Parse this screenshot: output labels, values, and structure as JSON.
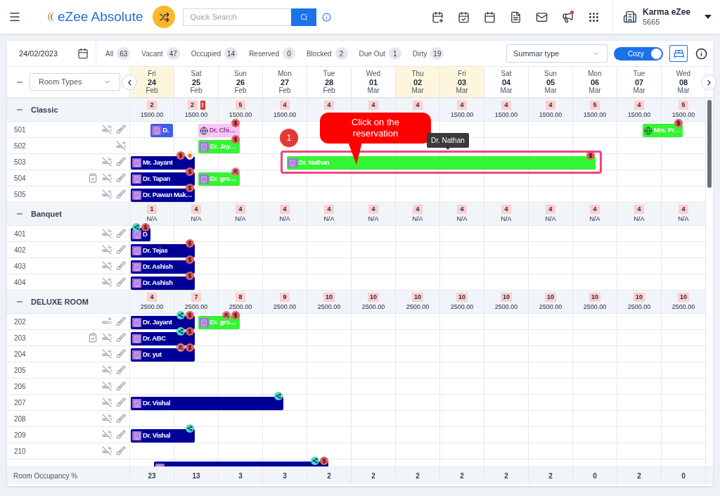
{
  "header": {
    "app_name": "eZee Absolute",
    "search": {
      "placeholder": "Quick Search"
    },
    "notification_dot": true,
    "property": {
      "name": "Karma eZee",
      "code": "5665"
    }
  },
  "filter_bar": {
    "date": "24/02/2023",
    "filters": [
      {
        "label": "All",
        "count": "63"
      },
      {
        "label": "Vacant",
        "count": "47"
      },
      {
        "label": "Occupied",
        "count": "14"
      },
      {
        "label": "Reserved",
        "count": "0"
      },
      {
        "label": "Blocked",
        "count": "2"
      },
      {
        "label": "Due Out",
        "count": "1"
      },
      {
        "label": "Dirty",
        "count": "19"
      }
    ],
    "type_select": {
      "value": "Summar type"
    },
    "view_toggle": {
      "label": "Cozy",
      "on": true
    }
  },
  "grid": {
    "room_type_select": {
      "value": "Room Types"
    },
    "days": [
      {
        "day": "Fri",
        "date": "24",
        "month": "Feb",
        "highlight": true
      },
      {
        "day": "Sat",
        "date": "25",
        "month": "Feb",
        "highlight": false
      },
      {
        "day": "Sun",
        "date": "26",
        "month": "Feb",
        "highlight": false
      },
      {
        "day": "Mon",
        "date": "27",
        "month": "Feb",
        "highlight": false
      },
      {
        "day": "Tue",
        "date": "28",
        "month": "Feb",
        "highlight": false
      },
      {
        "day": "Wed",
        "date": "01",
        "month": "Mar",
        "highlight": false
      },
      {
        "day": "Thu",
        "date": "02",
        "month": "Mar",
        "highlight": true
      },
      {
        "day": "Fri",
        "date": "03",
        "month": "Mar",
        "highlight": true
      },
      {
        "day": "Sat",
        "date": "04",
        "month": "Mar",
        "highlight": false
      },
      {
        "day": "Sun",
        "date": "05",
        "month": "Mar",
        "highlight": false
      },
      {
        "day": "Mon",
        "date": "06",
        "month": "Mar",
        "highlight": false
      },
      {
        "day": "Tue",
        "date": "07",
        "month": "Mar",
        "highlight": false
      },
      {
        "day": "Wed",
        "date": "08",
        "month": "Mar",
        "highlight": false
      }
    ],
    "groups": [
      {
        "name": "Classic",
        "expanded": true,
        "cells": [
          {
            "count": "2",
            "rate": "1500.00"
          },
          {
            "count": "2",
            "alert": "!",
            "rate": "1500.00"
          },
          {
            "count": "5",
            "rate": "1500.00"
          },
          {
            "count": "4",
            "rate": "1500.00"
          },
          {
            "count": "4"
          },
          {
            "count": "4"
          },
          {
            "count": "4"
          },
          {
            "count": "4",
            "rate": "1500.00"
          },
          {
            "count": "4",
            "rate": "1500.00"
          },
          {
            "count": "4",
            "rate": "1500.00"
          },
          {
            "count": "5",
            "rate": "1500.00"
          },
          {
            "count": "4",
            "rate": "1500.00"
          },
          {
            "count": "5",
            "rate": "1500.00"
          }
        ],
        "rooms": [
          {
            "number": "501",
            "icons": [
              {
                "kind": "no-smoking"
              },
              {
                "kind": "clean"
              }
            ],
            "reservations": [
              {
                "guest": "D.",
                "color": "#3f5fe8",
                "kind": "direct"
              },
              {
                "guest": "Dr. Chi…",
                "color": "#f7c6f7",
                "kind": "web",
                "badges": [
                  {
                    "kind": "dollar"
                  }
                ]
              },
              {
                "guest": "Mrs. Pr…",
                "color": "#33f533",
                "kind": "web",
                "badges": [
                  {
                    "kind": "dollar"
                  }
                ]
              }
            ]
          },
          {
            "number": "502",
            "icons": [
              {
                "kind": "no-smoking"
              }
            ],
            "reservations": [
              {
                "guest": "Dr. Jay…",
                "color": "#33f533",
                "kind": "direct",
                "badges": [
                  {
                    "kind": "dollar"
                  }
                ]
              }
            ]
          },
          {
            "number": "503",
            "icons": [
              {
                "kind": "no-smoking"
              },
              {
                "kind": "clean"
              }
            ],
            "reservations": [
              {
                "guest": "Mr. Jayant",
                "color": "#000099",
                "kind": "direct",
                "badges": [
                  {
                    "kind": "dollar"
                  },
                  {
                    "kind": "star"
                  }
                ]
              },
              {
                "guest": "Dr. Nathan",
                "color": "#33f533",
                "kind": "direct",
                "highlighted": true,
                "badges": [
                  {
                    "kind": "dollar"
                  }
                ]
              }
            ]
          },
          {
            "number": "504",
            "icons": [
              {
                "kind": "checklist"
              },
              {
                "kind": "no-smoking"
              },
              {
                "kind": "clean"
              }
            ],
            "reservations": [
              {
                "guest": "Dr. Tapan",
                "color": "#000099",
                "kind": "direct",
                "badges": [
                  {
                    "kind": "dollar"
                  }
                ]
              },
              {
                "guest": "Dr. gro…",
                "color": "#33f533",
                "kind": "direct",
                "badges": [
                  {
                    "kind": "group"
                  }
                ]
              }
            ]
          },
          {
            "number": "505",
            "icons": [
              {
                "kind": "no-smoking"
              },
              {
                "kind": "clean"
              }
            ],
            "reservations": [
              {
                "guest": "Dr. Pawan Mak…",
                "color": "#000099",
                "kind": "direct",
                "badges": [
                  {
                    "kind": "dollar"
                  }
                ]
              }
            ]
          }
        ]
      },
      {
        "name": "Banquet",
        "expanded": true,
        "cells": [
          {
            "count": "1",
            "rate": "N/A"
          },
          {
            "count": "4",
            "rate": "N/A"
          },
          {
            "count": "4",
            "rate": "N/A"
          },
          {
            "count": "4",
            "rate": "N/A"
          },
          {
            "count": "4",
            "rate": "N/A"
          },
          {
            "count": "4",
            "rate": "N/A"
          },
          {
            "count": "4",
            "rate": "N/A"
          },
          {
            "count": "4",
            "rate": "N/A"
          },
          {
            "count": "4",
            "rate": "N/A"
          },
          {
            "count": "4",
            "rate": "N/A"
          },
          {
            "count": "4",
            "rate": "N/A"
          },
          {
            "count": "4",
            "rate": "N/A"
          },
          {
            "count": "4",
            "rate": "N/A"
          }
        ],
        "rooms": [
          {
            "number": "401",
            "icons": [
              {
                "kind": "no-smoking"
              },
              {
                "kind": "clean"
              }
            ],
            "reservations": [
              {
                "guest": "D",
                "color": "#000099",
                "kind": "direct",
                "badges": [
                  {
                    "kind": "share"
                  },
                  {
                    "kind": "dollar"
                  }
                ]
              }
            ]
          },
          {
            "number": "402",
            "icons": [
              {
                "kind": "no-smoking"
              },
              {
                "kind": "clean"
              }
            ],
            "reservations": [
              {
                "guest": "Dr. Tejas",
                "color": "#000099",
                "kind": "direct",
                "badges": [
                  {
                    "kind": "dollar"
                  }
                ]
              }
            ]
          },
          {
            "number": "403",
            "icons": [
              {
                "kind": "no-smoking"
              },
              {
                "kind": "clean"
              }
            ],
            "reservations": [
              {
                "guest": "Dr. Ashish",
                "color": "#000099",
                "kind": "direct",
                "badges": [
                  {
                    "kind": "dollar"
                  }
                ]
              }
            ]
          },
          {
            "number": "404",
            "icons": [
              {
                "kind": "no-smoking"
              },
              {
                "kind": "clean"
              }
            ],
            "reservations": [
              {
                "guest": "Dr. Ashish",
                "color": "#000099",
                "kind": "direct",
                "badges": [
                  {
                    "kind": "dollar"
                  }
                ]
              }
            ]
          }
        ]
      },
      {
        "name": "DELUXE ROOM",
        "expanded": true,
        "cells": [
          {
            "count": "4",
            "rate": "2500.00"
          },
          {
            "count": "7",
            "rate": "2500.00"
          },
          {
            "count": "8",
            "rate": "2500.00"
          },
          {
            "count": "9",
            "rate": "2500.00"
          },
          {
            "count": "10",
            "rate": "2500.00"
          },
          {
            "count": "10",
            "rate": "2500.00"
          },
          {
            "count": "10",
            "rate": "2500.00"
          },
          {
            "count": "10",
            "rate": "2500.00"
          },
          {
            "count": "10",
            "rate": "2500.00"
          },
          {
            "count": "10",
            "rate": "2500.00"
          },
          {
            "count": "10",
            "rate": "2500.00"
          },
          {
            "count": "10",
            "rate": "2500.00"
          },
          {
            "count": "10",
            "rate": "2500.00"
          }
        ],
        "rooms": [
          {
            "number": "202",
            "icons": [
              {
                "kind": "smoking"
              },
              {
                "kind": "clean"
              }
            ],
            "reservations": [
              {
                "guest": "Dr. Jayant",
                "color": "#000099",
                "kind": "direct",
                "badges": [
                  {
                    "kind": "share"
                  },
                  {
                    "kind": "dollar"
                  }
                ]
              },
              {
                "guest": "Dr. gro…",
                "color": "#33f533",
                "kind": "direct",
                "badges": [
                  {
                    "kind": "group"
                  },
                  {
                    "kind": "dollar"
                  }
                ]
              }
            ]
          },
          {
            "number": "203",
            "icons": [
              {
                "kind": "checklist"
              },
              {
                "kind": "no-smoking"
              },
              {
                "kind": "clean"
              }
            ],
            "reservations": [
              {
                "guest": "Dr. ABC",
                "color": "#000099",
                "kind": "direct",
                "badges": [
                  {
                    "kind": "share"
                  },
                  {
                    "kind": "dollar"
                  }
                ]
              }
            ]
          },
          {
            "number": "204",
            "icons": [
              {
                "kind": "no-smoking"
              },
              {
                "kind": "clean"
              }
            ],
            "reservations": [
              {
                "guest": "Dr. yut",
                "color": "#000099",
                "kind": "direct",
                "badges": [
                  {
                    "kind": "group"
                  },
                  {
                    "kind": "dollar"
                  }
                ]
              }
            ]
          },
          {
            "number": "205",
            "icons": [
              {
                "kind": "no-smoking"
              },
              {
                "kind": "clean"
              }
            ]
          },
          {
            "number": "206",
            "icons": [
              {
                "kind": "no-smoking"
              },
              {
                "kind": "clean"
              }
            ]
          },
          {
            "number": "207",
            "icons": [
              {
                "kind": "no-smoking"
              },
              {
                "kind": "clean"
              }
            ],
            "reservations": [
              {
                "guest": "Dr. Vishal",
                "color": "#000099",
                "kind": "direct",
                "badges": [
                  {
                    "kind": "share"
                  }
                ]
              }
            ]
          },
          {
            "number": "208",
            "icons": [
              {
                "kind": "no-smoking"
              },
              {
                "kind": "clean"
              }
            ]
          },
          {
            "number": "209",
            "icons": [
              {
                "kind": "no-smoking"
              },
              {
                "kind": "clean"
              }
            ],
            "reservations": [
              {
                "guest": "Dr. Vishal",
                "color": "#000099",
                "kind": "direct",
                "badges": [
                  {
                    "kind": "share"
                  }
                ]
              }
            ]
          },
          {
            "number": "210",
            "icons": [
              {
                "kind": "no-smoking"
              },
              {
                "kind": "clean"
              }
            ]
          },
          {
            "reservations": [
              {
                "color": "#000099",
                "kind": "direct",
                "badges": [
                  {
                    "kind": "share"
                  },
                  {
                    "kind": "dollar"
                  }
                ]
              }
            ]
          }
        ]
      }
    ],
    "footer": {
      "label": "Room Occupancy %",
      "values": [
        "23",
        "13",
        "3",
        "3",
        "2",
        "2",
        "2",
        "2",
        "2",
        "2",
        "0",
        "2",
        "0"
      ]
    }
  },
  "tutorial": {
    "step": "1",
    "callout": "Click on the reservation",
    "tooltip": "Dr. Nathan"
  }
}
